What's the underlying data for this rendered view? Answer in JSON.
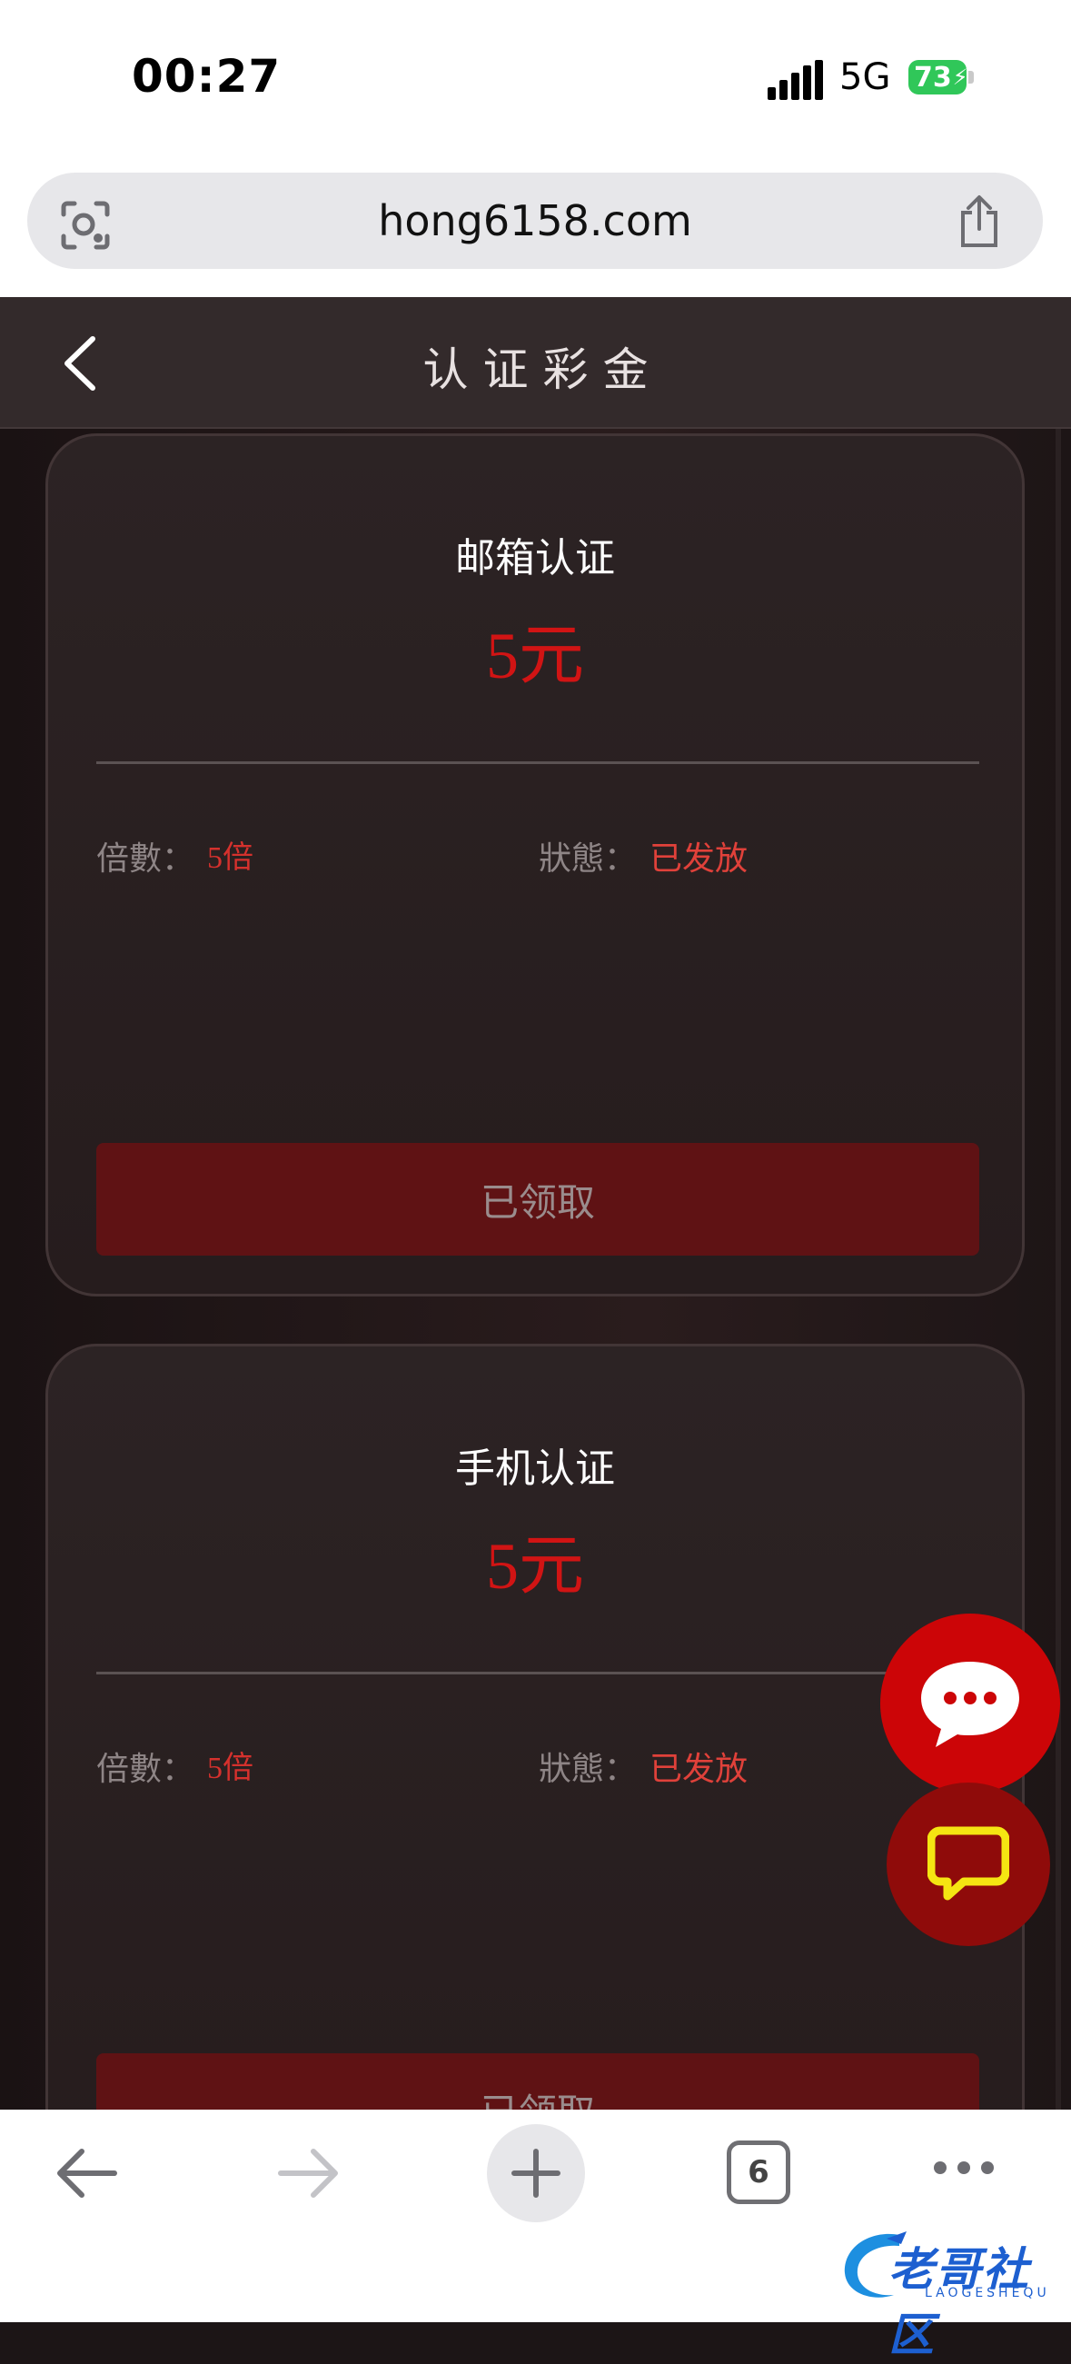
{
  "status_bar": {
    "time": "00:27",
    "network": "5G",
    "battery": "73"
  },
  "browser": {
    "url": "hong6158.com",
    "tab_count": "6"
  },
  "header": {
    "title": "认证彩金"
  },
  "cards": [
    {
      "title": "邮箱认证",
      "amount": "5元",
      "multiplier_label": "倍數：",
      "multiplier_value": "5倍",
      "status_label": "狀態：",
      "status_value": "已发放",
      "button_label": "已领取"
    },
    {
      "title": "手机认证",
      "amount": "5元",
      "multiplier_label": "倍數：",
      "multiplier_value": "5倍",
      "status_label": "狀態：",
      "status_value": "已发放",
      "button_label": "已领取"
    }
  ],
  "watermark": {
    "text": "老哥社区",
    "sub": "LAOGESHEQU"
  },
  "colors": {
    "accent_red": "#d11414",
    "button_dark_red": "#5f1214",
    "chat_fab": "#cc0507",
    "support_fab": "#8f0b0a"
  }
}
